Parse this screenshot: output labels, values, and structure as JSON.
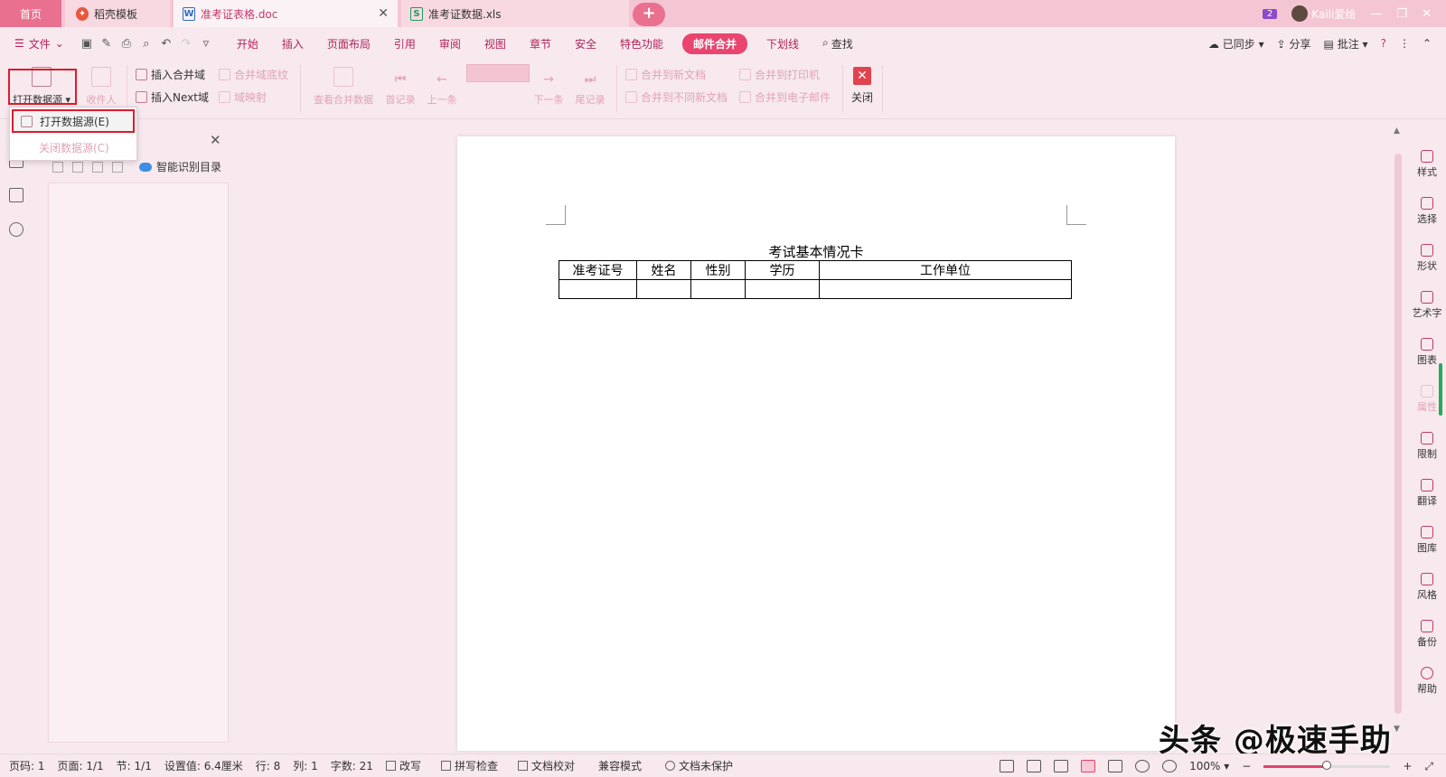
{
  "tabs": {
    "home": "首页",
    "template": "稻壳模板",
    "doc": "准考证表格.doc",
    "xls": "准考证数据.xls",
    "doc_icon": "W",
    "xls_icon": "S"
  },
  "window": {
    "badge": "2",
    "user": "Kaili爱绘"
  },
  "menu": {
    "file": "文件",
    "items": [
      "开始",
      "插入",
      "页面布局",
      "引用",
      "审阅",
      "视图",
      "章节",
      "安全",
      "特色功能"
    ],
    "active": "邮件合并",
    "after": [
      "下划线"
    ],
    "search": "查找",
    "sync": "已同步",
    "share": "分享",
    "comment": "批注",
    "help": "?"
  },
  "ribbon": {
    "open_source": "打开数据源",
    "recipients": "收件人",
    "insert_merge_field": "插入合并域",
    "merge_field_shading": "合并域底纹",
    "insert_next": "插入Next域",
    "field_mapping": "域映射",
    "view_merged": "查看合并数据",
    "first_record": "首记录",
    "prev": "上一条",
    "next": "下一条",
    "last_record": "尾记录",
    "merge_to_new_doc": "合并到新文档",
    "merge_to_different_docs": "合并到不同新文档",
    "merge_to_printer": "合并到打印机",
    "merge_to_email": "合并到电子邮件",
    "close": "关闭"
  },
  "dropdown": {
    "open": "打开数据源(E)",
    "close": "关闭数据源(C)"
  },
  "navpane": {
    "smart_toc": "智能识别目录"
  },
  "document": {
    "title": "考试基本情况卡",
    "headers": [
      "准考证号",
      "姓名",
      "性别",
      "学历",
      "工作单位"
    ]
  },
  "rightbar": [
    "样式",
    "选择",
    "形状",
    "艺术字",
    "图表",
    "属性",
    "限制",
    "翻译",
    "图库",
    "风格",
    "备份",
    "帮助"
  ],
  "status": {
    "page_no": "页码: 1",
    "pages": "页面: 1/1",
    "section": "节: 1/1",
    "setting": "设置值: 6.4厘米",
    "row": "行: 8",
    "col": "列: 1",
    "words": "字数: 21",
    "overtype": "改写",
    "spell": "拼写检查",
    "proof": "文档校对",
    "compat": "兼容模式",
    "protect": "文档未保护",
    "zoom": "100%",
    "zoom_level": 0.5
  },
  "watermark": "头条 @极速手助",
  "colors": {
    "accent": "#e9456f",
    "highlight": "#e01a2b"
  }
}
